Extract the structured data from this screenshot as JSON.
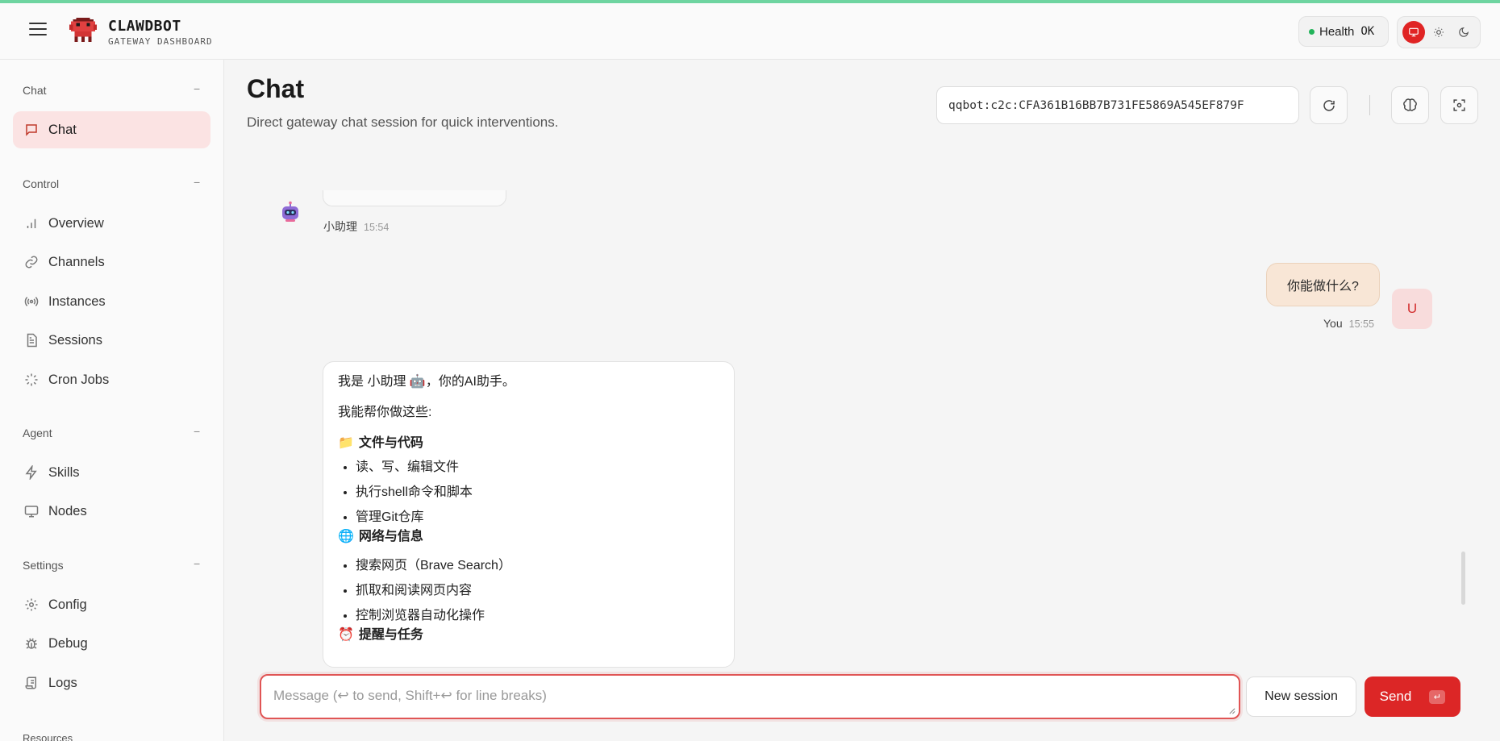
{
  "header": {
    "brand_name": "CLAWDBOT",
    "brand_sub": "GATEWAY DASHBOARD",
    "health_label": "Health",
    "health_status": "OK",
    "accent_color": "#dc2626",
    "status_color": "#22b35a",
    "theme_selected": "system"
  },
  "sidebar": {
    "groups": [
      {
        "title": "Chat",
        "collapse": "−",
        "items": [
          {
            "label": "Chat",
            "icon": "chat-bubble-icon",
            "active": true
          }
        ]
      },
      {
        "title": "Control",
        "collapse": "−",
        "items": [
          {
            "label": "Overview",
            "icon": "bar-chart-icon"
          },
          {
            "label": "Channels",
            "icon": "link-icon"
          },
          {
            "label": "Instances",
            "icon": "radio-icon"
          },
          {
            "label": "Sessions",
            "icon": "document-icon"
          },
          {
            "label": "Cron Jobs",
            "icon": "loader-icon"
          }
        ]
      },
      {
        "title": "Agent",
        "collapse": "−",
        "items": [
          {
            "label": "Skills",
            "icon": "zap-icon"
          },
          {
            "label": "Nodes",
            "icon": "monitor-icon"
          }
        ]
      },
      {
        "title": "Settings",
        "collapse": "−",
        "items": [
          {
            "label": "Config",
            "icon": "gear-icon"
          },
          {
            "label": "Debug",
            "icon": "bug-icon"
          },
          {
            "label": "Logs",
            "icon": "scroll-icon"
          }
        ]
      },
      {
        "title": "Resources"
      }
    ]
  },
  "main": {
    "title": "Chat",
    "subtitle": "Direct gateway chat session for quick interventions.",
    "session_key": "qqbot:c2c:CFA361B16BB7B731FE5869A545EF879F"
  },
  "messages": {
    "prev_assistant": {
      "sender": "小助理",
      "time": "15:54"
    },
    "user": {
      "text": "你能做什么?",
      "sender": "You",
      "time": "15:55",
      "avatar_letter": "U"
    },
    "assistant": {
      "intro": "我是 小助理 🤖，你的AI助手。",
      "lead": "我能帮你做这些:",
      "sections": [
        {
          "emoji": "📁",
          "title": "文件与代码",
          "items": [
            "读、写、编辑文件",
            "执行shell命令和脚本",
            "管理Git仓库"
          ]
        },
        {
          "emoji": "🌐",
          "title": "网络与信息",
          "items": [
            "搜索网页（Brave Search）",
            "抓取和阅读网页内容",
            "控制浏览器自动化操作"
          ]
        },
        {
          "emoji": "⏰",
          "title": "提醒与任务",
          "items": []
        }
      ]
    }
  },
  "composer": {
    "placeholder": "Message (↩ to send, Shift+↩ for line breaks)",
    "new_session_label": "New session",
    "send_label": "Send",
    "send_kbd": "↵"
  }
}
